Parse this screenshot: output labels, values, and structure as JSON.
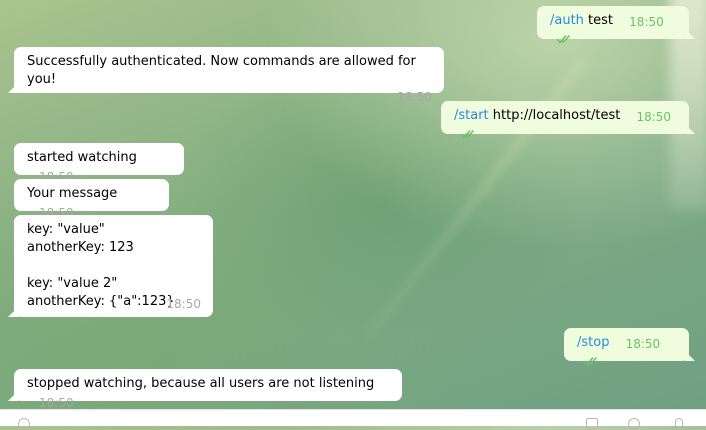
{
  "messages": [
    {
      "id": "m1",
      "direction": "out",
      "command": "/auth",
      "text": " test",
      "time": "18:50",
      "status_icon": "double-check-icon"
    },
    {
      "id": "m2",
      "direction": "in",
      "text": "Successfully authenticated. Now commands are allowed for you!",
      "time": "18:50"
    },
    {
      "id": "m3",
      "direction": "out",
      "command": "/start",
      "text": " http://localhost/test",
      "time": "18:50",
      "status_icon": "double-check-icon"
    },
    {
      "id": "m4",
      "direction": "in",
      "text": "started watching",
      "time": "18:50"
    },
    {
      "id": "m5",
      "direction": "in",
      "text": "Your message",
      "time": "18:50"
    },
    {
      "id": "m6",
      "direction": "in",
      "text": "key: \"value\"\nanotherKey: 123\n\nkey: \"value 2\"\nanotherKey: {\"a\":123}",
      "time": "18:50"
    },
    {
      "id": "m7",
      "direction": "out",
      "command": "/stop",
      "text": "",
      "time": "18:50",
      "status_icon": "double-check-icon"
    },
    {
      "id": "m8",
      "direction": "in",
      "text": "stopped watching, because all users are not listening",
      "time": "18:50"
    }
  ],
  "colors": {
    "incoming_bubble": "#ffffff",
    "outgoing_bubble": "#effdde",
    "command_link": "#2a8ad6",
    "read_check": "#6cc264",
    "timestamp": "#a8a8a8"
  },
  "input_bar": {
    "icons": [
      "attach-icon",
      "sticker-icon",
      "emoji-icon",
      "mic-icon"
    ]
  }
}
